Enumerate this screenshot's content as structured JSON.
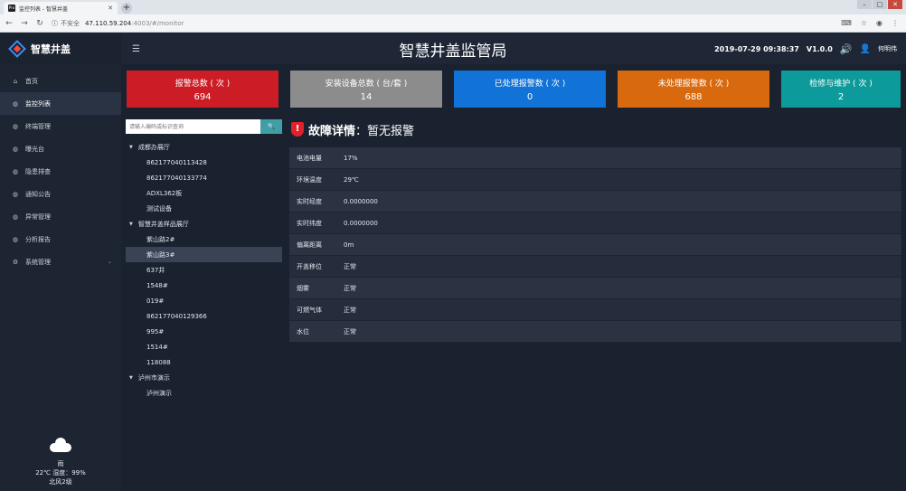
{
  "browser": {
    "tab_title": "监控列表 - 智慧井盖",
    "insecure_label": "不安全",
    "url_host": "47.110.59.204",
    "url_path": ":4003/#/monitor"
  },
  "header": {
    "logo_text": "智慧井盖",
    "title": "智慧井盖监管局",
    "datetime": "2019-07-29 09:38:37",
    "version": "V1.0.0",
    "user": "何明伟"
  },
  "sidebar": {
    "items": [
      {
        "label": "首页",
        "icon": "home-icon"
      },
      {
        "label": "监控列表",
        "icon": "monitor-icon"
      },
      {
        "label": "终端管理",
        "icon": "terminal-icon"
      },
      {
        "label": "曝光台",
        "icon": "exposure-icon"
      },
      {
        "label": "隐患排查",
        "icon": "hazard-icon"
      },
      {
        "label": "通知公告",
        "icon": "notice-icon"
      },
      {
        "label": "异常管理",
        "icon": "exception-icon"
      },
      {
        "label": "分析报告",
        "icon": "report-icon"
      },
      {
        "label": "系统管理",
        "icon": "settings-icon"
      }
    ]
  },
  "weather": {
    "condition": "雨",
    "temp_humidity": "22℃ 湿度：99%",
    "wind": "北风2级"
  },
  "cards": [
    {
      "label": "报警总数 ( 次 )",
      "value": "694",
      "color": "#cc1c25"
    },
    {
      "label": "安装设备总数 ( 台/套 )",
      "value": "14",
      "color": "#8c8c8c"
    },
    {
      "label": "已处理报警数 ( 次 )",
      "value": "0",
      "color": "#1172d8"
    },
    {
      "label": "未处理报警数 ( 次 )",
      "value": "688",
      "color": "#d9690e"
    },
    {
      "label": "检修与维护 ( 次 )",
      "value": "2",
      "color": "#0d9a9a"
    }
  ],
  "search": {
    "placeholder": "请输入编码或标识查询"
  },
  "tree": {
    "groups": [
      {
        "label": "成都办展厅",
        "children": [
          "862177040113428",
          "862177040133774",
          "ADXL362板",
          "测试设备"
        ]
      },
      {
        "label": "智慧井盖样品展厅",
        "children": [
          "紫山路2#",
          "紫山路3#",
          "637井",
          "1548#",
          "019#",
          "862177040129366",
          "995#",
          "1514#",
          "118088"
        ]
      },
      {
        "label": "泸州市演示",
        "children": [
          "泸州演示"
        ]
      }
    ]
  },
  "detail": {
    "title_prefix": "故障详情",
    "title_sep": "：",
    "title_value": "暂无报警",
    "rows": [
      {
        "key": "电池电量",
        "value": "17%"
      },
      {
        "key": "环境温度",
        "value": "29℃"
      },
      {
        "key": "实时经度",
        "value": "0.0000000"
      },
      {
        "key": "实时纬度",
        "value": "0.0000000"
      },
      {
        "key": "偏离距离",
        "value": "0m"
      },
      {
        "key": "开盖移位",
        "value": "正常"
      },
      {
        "key": "烟雾",
        "value": "正常"
      },
      {
        "key": "可燃气体",
        "value": "正常"
      },
      {
        "key": "水位",
        "value": "正常"
      }
    ]
  }
}
